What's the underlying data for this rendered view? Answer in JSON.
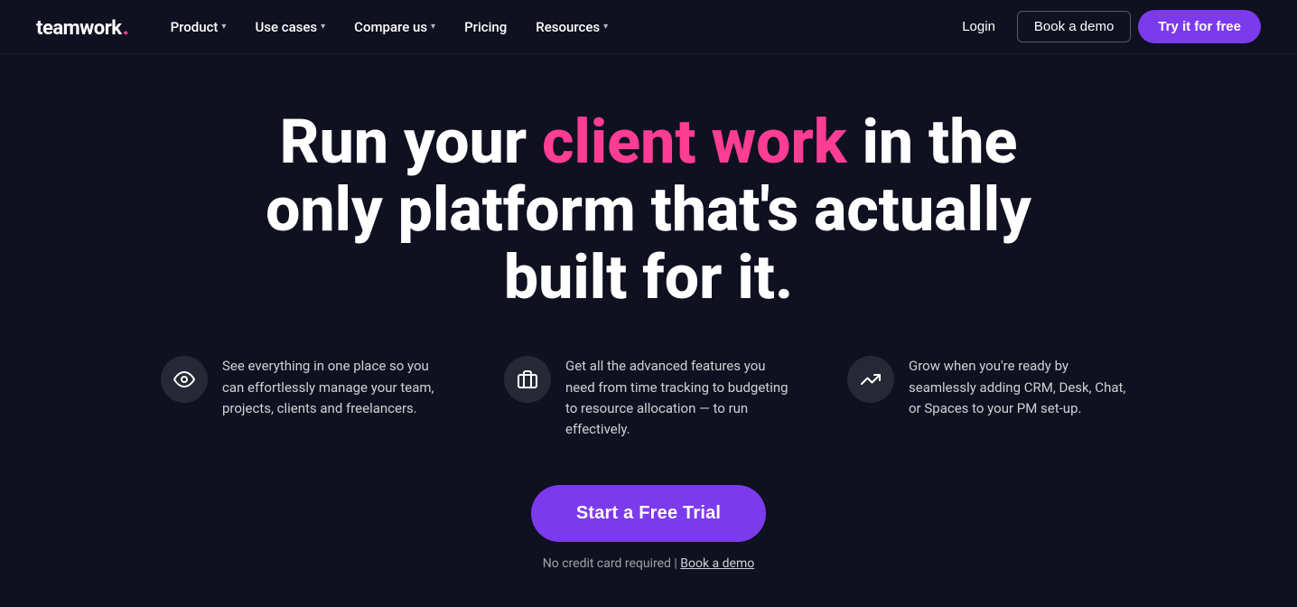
{
  "nav": {
    "logo_text": "teamwork",
    "logo_dot": ".",
    "links": [
      {
        "label": "Product",
        "has_dropdown": true
      },
      {
        "label": "Use cases",
        "has_dropdown": true
      },
      {
        "label": "Compare us",
        "has_dropdown": true
      },
      {
        "label": "Pricing",
        "has_dropdown": false
      },
      {
        "label": "Resources",
        "has_dropdown": true
      }
    ],
    "login_label": "Login",
    "demo_label": "Book a demo",
    "try_label": "Try it for free"
  },
  "hero": {
    "title_part1": "Run your ",
    "title_highlight": "client work",
    "title_part2": " in the only platform that's actually built for it."
  },
  "features": [
    {
      "icon": "👁",
      "icon_name": "eye-icon",
      "text": "See everything in one place so you can effortlessly manage your team, projects, clients and freelancers."
    },
    {
      "icon": "💼",
      "icon_name": "briefcase-icon",
      "text": "Get all the advanced features you need from time tracking to budgeting to resource allocation — to run effectively."
    },
    {
      "icon": "📈",
      "icon_name": "growth-icon",
      "text": "Grow when you're ready by seamlessly adding CRM, Desk, Chat, or Spaces to your PM set-up."
    }
  ],
  "cta": {
    "button_label": "Start a Free Trial",
    "subtext_prefix": "No credit card required | ",
    "subtext_link": "Book a demo"
  }
}
